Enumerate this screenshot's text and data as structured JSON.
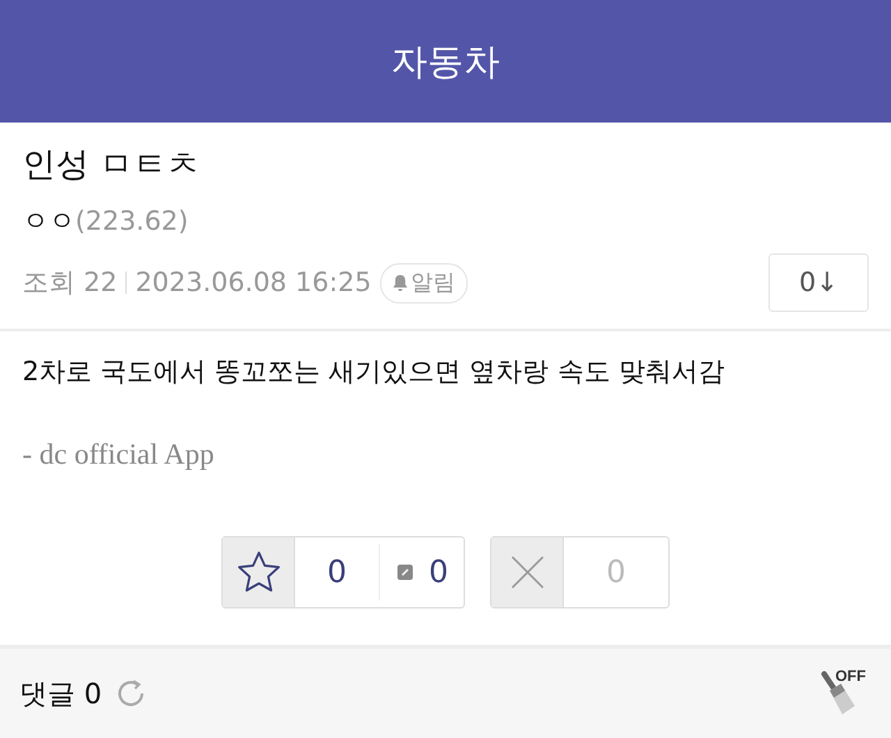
{
  "header": {
    "title": "자동차"
  },
  "post": {
    "title": "인성 ㅁㅌㅊ",
    "author": "ㅇㅇ",
    "ip": "(223.62)",
    "views_label": "조회 22",
    "date": "2023.06.08 16:25",
    "alarm": "알림",
    "down_button": "0↓"
  },
  "body": {
    "text": "2차로 국도에서 똥꼬쪼는 새기있으면 옆차랑 속도 맞춰서감",
    "signature": "- dc official App"
  },
  "votes": {
    "up": "0",
    "fix": "0",
    "down": "0"
  },
  "footer": {
    "comments": "댓글 0",
    "filter": "OFF"
  }
}
